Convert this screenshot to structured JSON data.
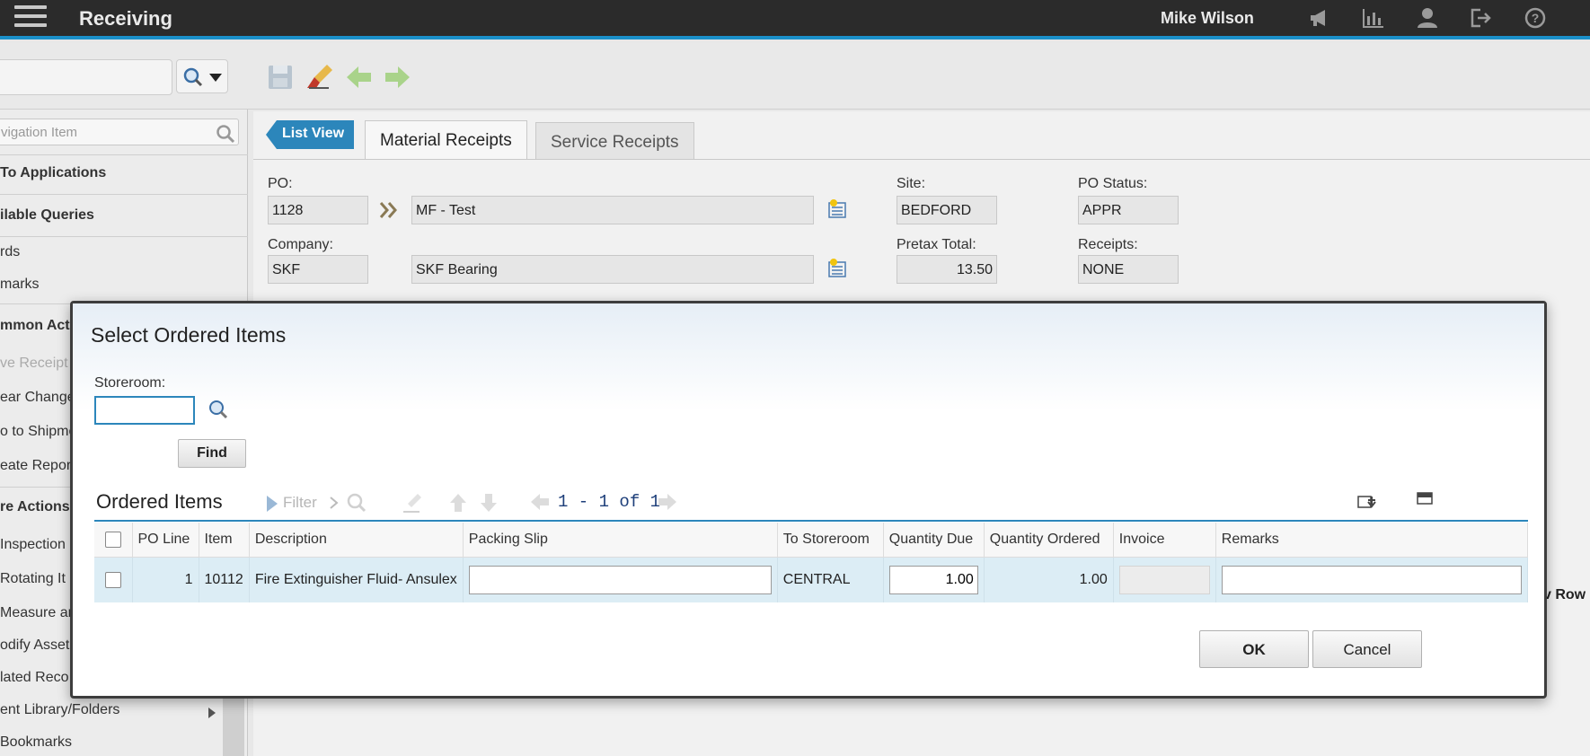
{
  "header": {
    "app_title": "Receiving",
    "user_name": "Mike Wilson",
    "icons": [
      "megaphone-icon",
      "reports-icon",
      "user-profile-icon",
      "sign-out-icon",
      "help-icon"
    ]
  },
  "toolbar": {
    "search_value": "",
    "icons": [
      "save-icon",
      "clear-changes-icon",
      "previous-record-icon",
      "next-record-icon"
    ]
  },
  "leftnav": {
    "search_placeholder": "vigation Item",
    "items": [
      {
        "label": "To Applications",
        "type": "head"
      },
      {
        "label": "ilable Queries",
        "type": "head"
      },
      {
        "label": "rds",
        "type": "item"
      },
      {
        "label": "marks",
        "type": "item"
      },
      {
        "label": "mmon Acti",
        "type": "head"
      },
      {
        "label": "ve Receipt",
        "type": "disabled"
      },
      {
        "label": "ear Change",
        "type": "item"
      },
      {
        "label": "o to Shipme",
        "type": "item"
      },
      {
        "label": "eate Repor",
        "type": "item"
      },
      {
        "label": "re Actions",
        "type": "head"
      },
      {
        "label": "Inspection",
        "type": "item"
      },
      {
        "label": "Rotating It",
        "type": "item"
      },
      {
        "label": "Measure an",
        "type": "item"
      },
      {
        "label": "odify Asset",
        "type": "item"
      },
      {
        "label": "lated Reco",
        "type": "item"
      },
      {
        "label": "ent Library/Folders",
        "type": "item"
      },
      {
        "label": "Bookmarks",
        "type": "item"
      }
    ]
  },
  "main": {
    "list_view_label": "List View",
    "tabs": [
      {
        "label": "Material Receipts",
        "active": true
      },
      {
        "label": "Service Receipts",
        "active": false
      }
    ],
    "fields": {
      "po_label": "PO:",
      "po_value": "1128",
      "po_desc": "MF - Test",
      "company_label": "Company:",
      "company_value": "SKF",
      "company_desc": "SKF Bearing",
      "site_label": "Site:",
      "site_value": "BEDFORD",
      "pretax_label": "Pretax Total:",
      "pretax_value": "13.50",
      "po_status_label": "PO Status:",
      "po_status_value": "APPR",
      "receipts_label": "Receipts:",
      "receipts_value": "NONE"
    },
    "bg_fragment": "v Row"
  },
  "modal": {
    "title": "Select Ordered Items",
    "storeroom_label": "Storeroom:",
    "storeroom_value": "",
    "find_label": "Find",
    "section_title": "Ordered Items",
    "filter_label": "Filter",
    "pager_text": "1 - 1 of 1",
    "columns": [
      "PO Line",
      "Item",
      "Description",
      "Packing Slip",
      "To Storeroom",
      "Quantity Due",
      "Quantity Ordered",
      "Invoice",
      "Remarks"
    ],
    "rows": [
      {
        "po_line": "1",
        "item": "10112",
        "description": "Fire Extinguisher Fluid- Ansulex",
        "packing_slip": "",
        "to_storeroom": "CENTRAL",
        "quantity_due": "1.00",
        "quantity_ordered": "1.00",
        "invoice": "",
        "remarks": ""
      }
    ],
    "ok_label": "OK",
    "cancel_label": "Cancel"
  },
  "colors": {
    "accent": "#2c86bb",
    "topbar": "#2b2b2b",
    "row_highlight": "#dcedf5"
  }
}
